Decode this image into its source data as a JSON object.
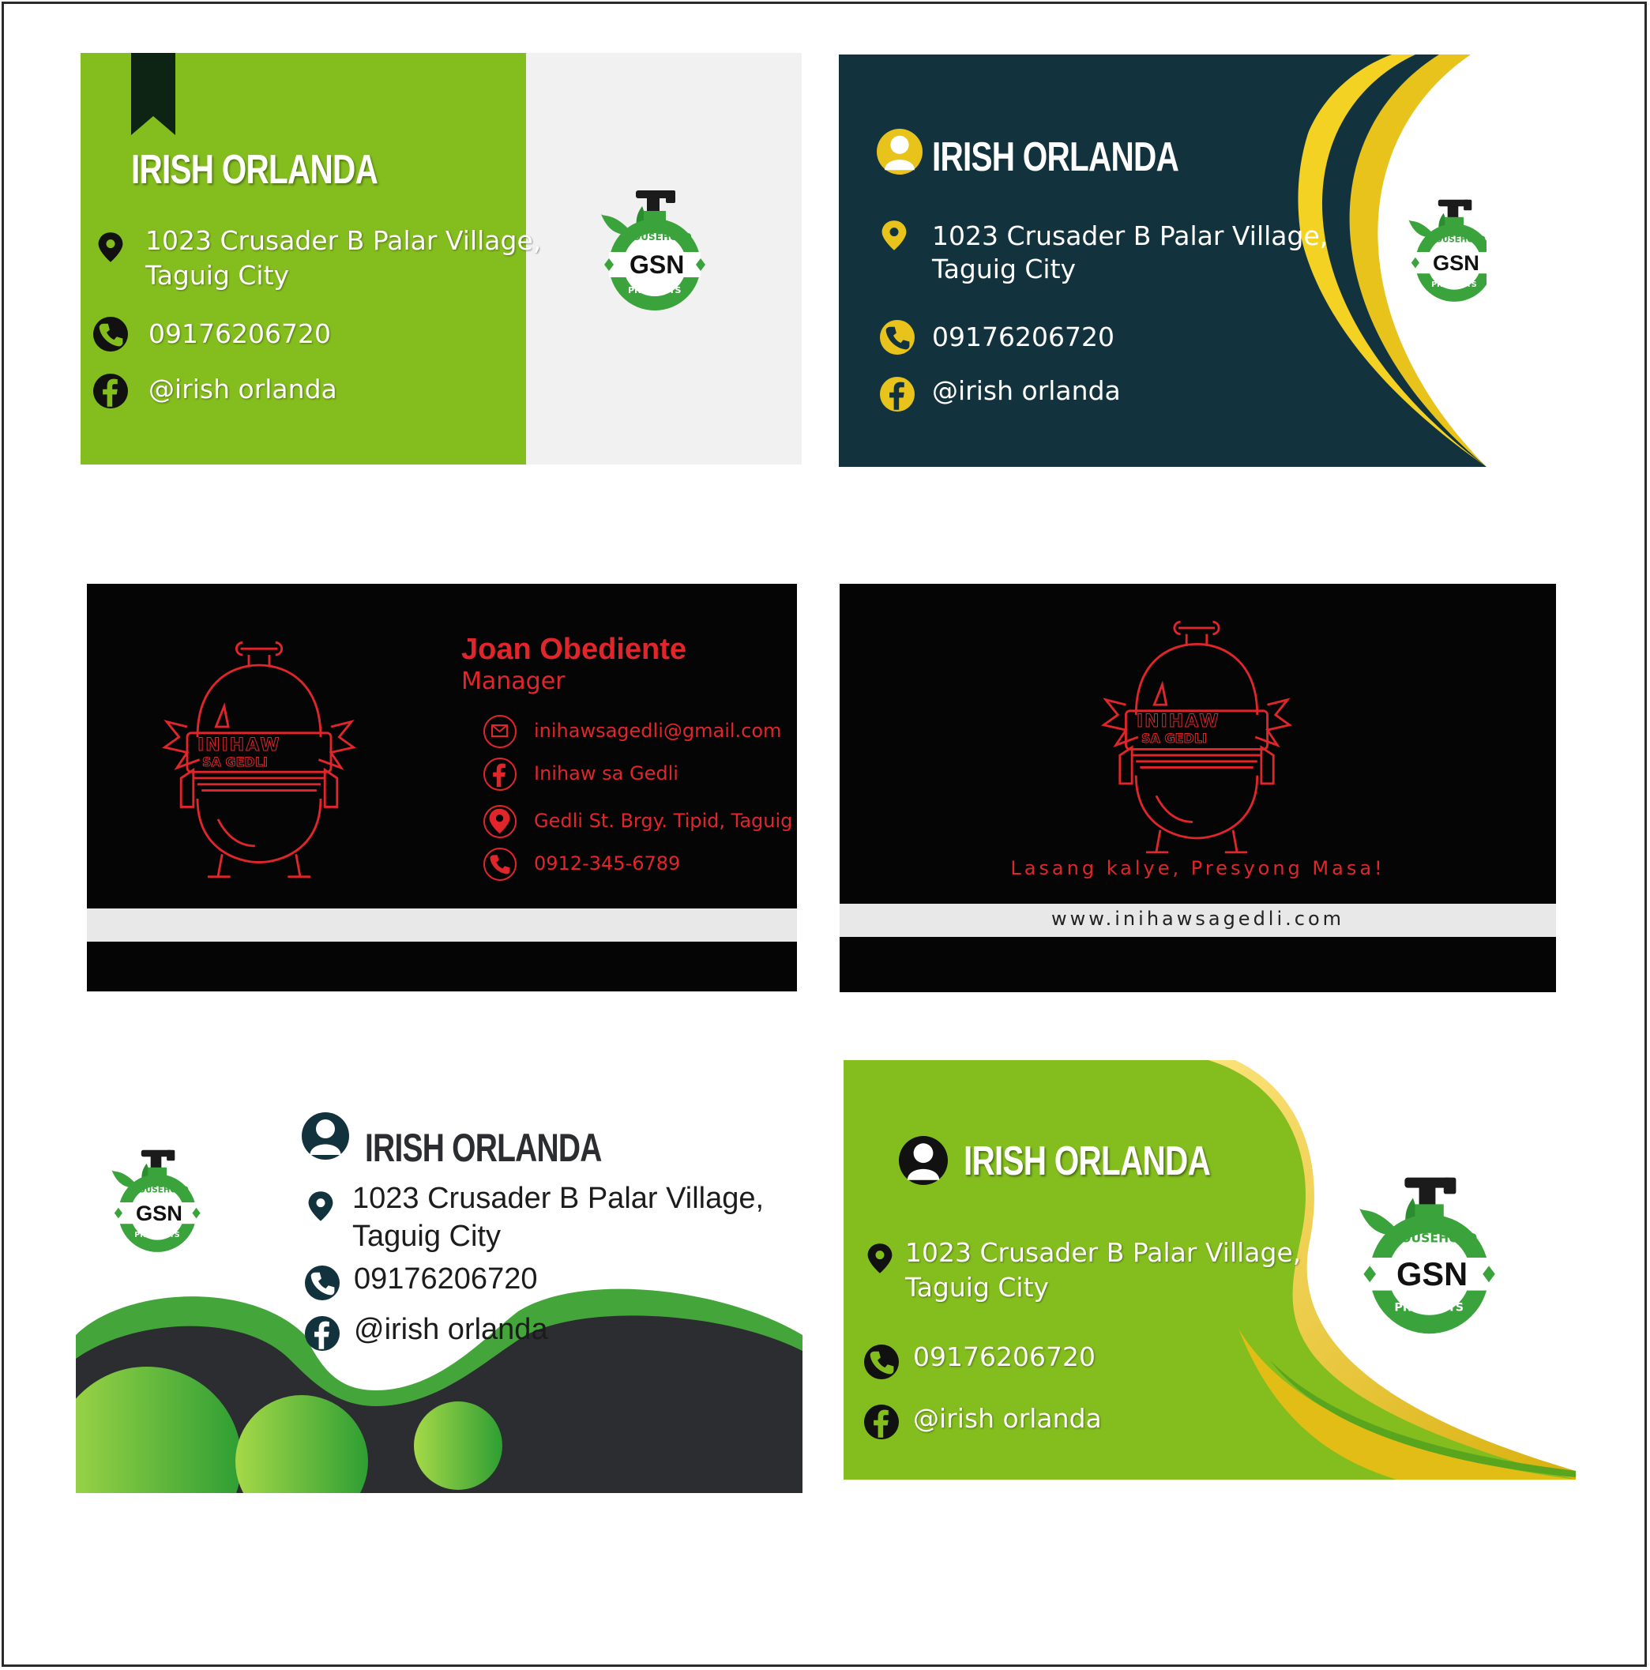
{
  "gsn_logo": {
    "top_text": "HOUSEHOLD",
    "center_text": "GSN",
    "bottom_text": "PRODUCTS"
  },
  "card1": {
    "name": "IRISH ORLANDA",
    "address_line1": "1023 Crusader B Palar Village,",
    "address_line2": "Taguig City",
    "phone": "09176206720",
    "facebook": "@irish orlanda"
  },
  "card2": {
    "name": "IRISH ORLANDA",
    "address_line1": "1023 Crusader B Palar Village,",
    "address_line2": "Taguig City",
    "phone": "09176206720",
    "facebook": "@irish orlanda"
  },
  "card3": {
    "name": "Joan Obediente",
    "title": "Manager",
    "email": "inihawsagedli@gmail.com",
    "facebook": "Inihaw sa Gedli",
    "address": "Gedli St. Brgy. Tipid, Taguig",
    "phone": "0912-345-6789"
  },
  "card4": {
    "tagline": "Lasang kalye, Presyong Masa!",
    "website": "www.inihawsagedli.com"
  },
  "inihaw_logo": {
    "line1": "INIHAW",
    "line2": "SA GEDLI"
  },
  "card5": {
    "name": "IRISH ORLANDA",
    "address_line1": "1023 Crusader B Palar Village,",
    "address_line2": "Taguig City",
    "phone": "09176206720",
    "facebook": "@irish orlanda"
  },
  "card6": {
    "name": "IRISH ORLANDA",
    "address_line1": "1023 Crusader B Palar Village,",
    "address_line2": "Taguig City",
    "phone": "09176206720",
    "facebook": "@irish orlanda"
  },
  "colors": {
    "lime": "#84bd1e",
    "navy": "#12333d",
    "gold": "#e8c31b",
    "red": "#e0262a",
    "black": "#050505",
    "charcoal": "#2c2d31",
    "logo_green": "#3aa33c"
  }
}
